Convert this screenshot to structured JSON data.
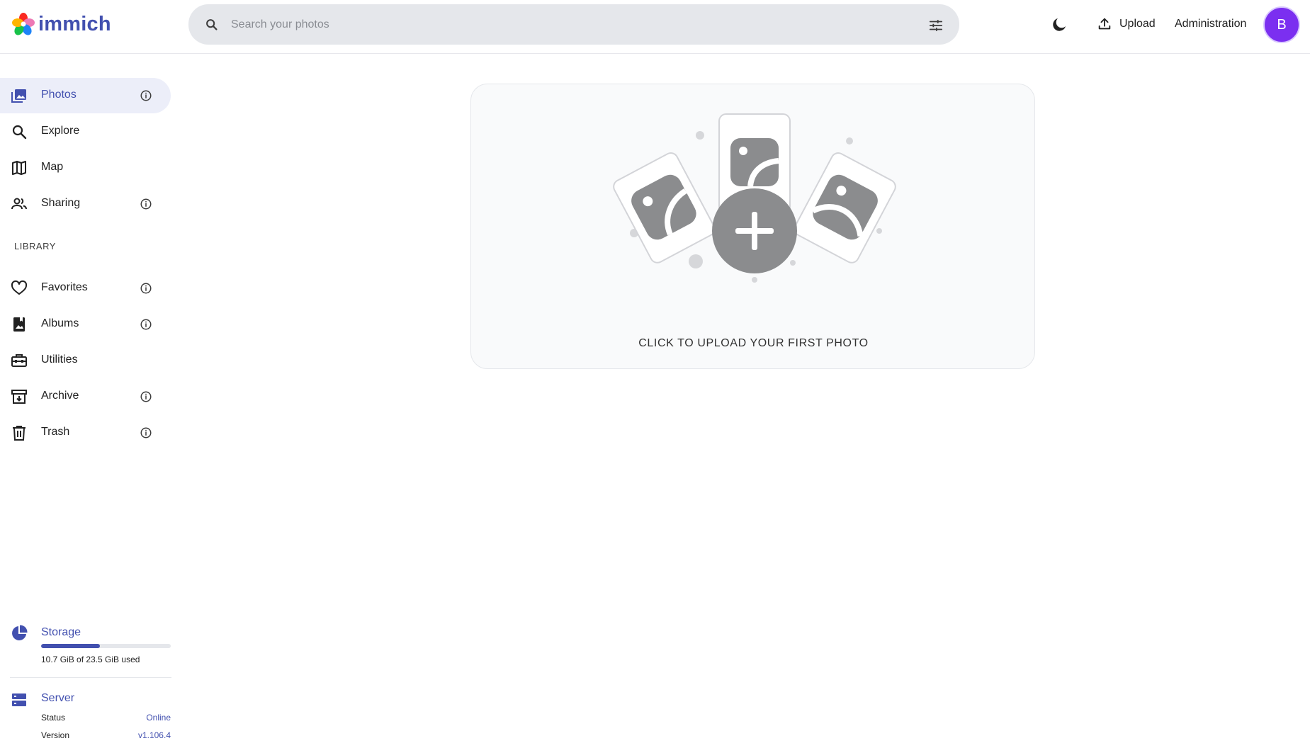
{
  "app": {
    "name": "immich"
  },
  "header": {
    "search_placeholder": "Search your photos",
    "upload_label": "Upload",
    "admin_label": "Administration",
    "avatar_initial": "B"
  },
  "sidebar": {
    "items": [
      {
        "label": "Photos",
        "icon": "photos-icon",
        "info": true,
        "active": true
      },
      {
        "label": "Explore",
        "icon": "explore-icon",
        "info": false
      },
      {
        "label": "Map",
        "icon": "map-icon",
        "info": false
      },
      {
        "label": "Sharing",
        "icon": "sharing-icon",
        "info": true
      }
    ],
    "library_label": "LIBRARY",
    "library_items": [
      {
        "label": "Favorites",
        "icon": "heart-icon",
        "info": true
      },
      {
        "label": "Albums",
        "icon": "albums-icon",
        "info": true
      },
      {
        "label": "Utilities",
        "icon": "toolbox-icon",
        "info": false
      },
      {
        "label": "Archive",
        "icon": "archive-icon",
        "info": true
      },
      {
        "label": "Trash",
        "icon": "trash-icon",
        "info": true
      }
    ],
    "storage": {
      "title": "Storage",
      "usage_text": "10.7 GiB of 23.5 GiB used",
      "used_fraction": 0.455
    },
    "server": {
      "title": "Server",
      "status_label": "Status",
      "status_value": "Online",
      "version_label": "Version",
      "version_value": "v1.106.4"
    }
  },
  "main": {
    "empty_text": "CLICK TO UPLOAD YOUR FIRST PHOTO"
  },
  "colors": {
    "accent": "#4250af",
    "avatar": "#7b2ff0",
    "active_bg": "#eceef9"
  }
}
